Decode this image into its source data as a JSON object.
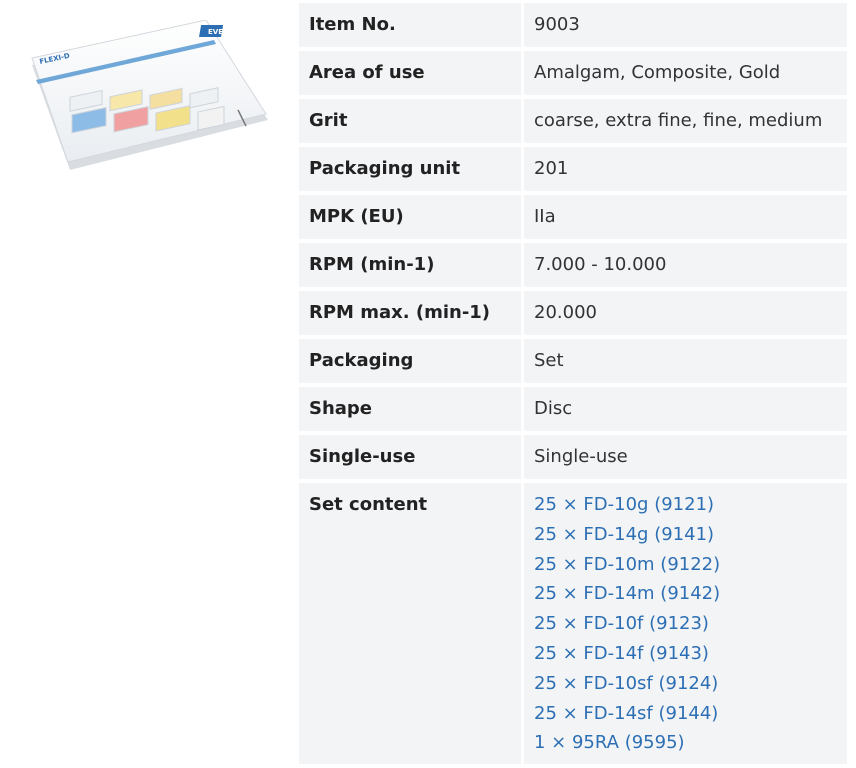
{
  "product_image": {
    "brand": "FLEXI-D",
    "logo": "EVE"
  },
  "specs": [
    {
      "label": "Item No.",
      "value": "9003"
    },
    {
      "label": "Area of use",
      "value": "Amalgam, Composite, Gold"
    },
    {
      "label": "Grit",
      "value": "coarse, extra fine, fine, medium"
    },
    {
      "label": "Packaging unit",
      "value": "201"
    },
    {
      "label": "MPK (EU)",
      "value": "IIa"
    },
    {
      "label": "RPM (min-1)",
      "value": "7.000 - 10.000"
    },
    {
      "label": "RPM max. (min-1)",
      "value": "20.000"
    },
    {
      "label": "Packaging",
      "value": "Set"
    },
    {
      "label": "Shape",
      "value": "Disc"
    },
    {
      "label": "Single-use",
      "value": "Single-use"
    }
  ],
  "set_content": {
    "label": "Set content",
    "items": [
      "25 × FD-10g (9121)",
      "25 × FD-14g (9141)",
      "25 × FD-10m (9122)",
      "25 × FD-14m (9142)",
      "25 × FD-10f (9123)",
      "25 × FD-14f (9143)",
      "25 × FD-10sf (9124)",
      "25 × FD-14sf (9144)",
      "1 × 95RA (9595)"
    ]
  }
}
